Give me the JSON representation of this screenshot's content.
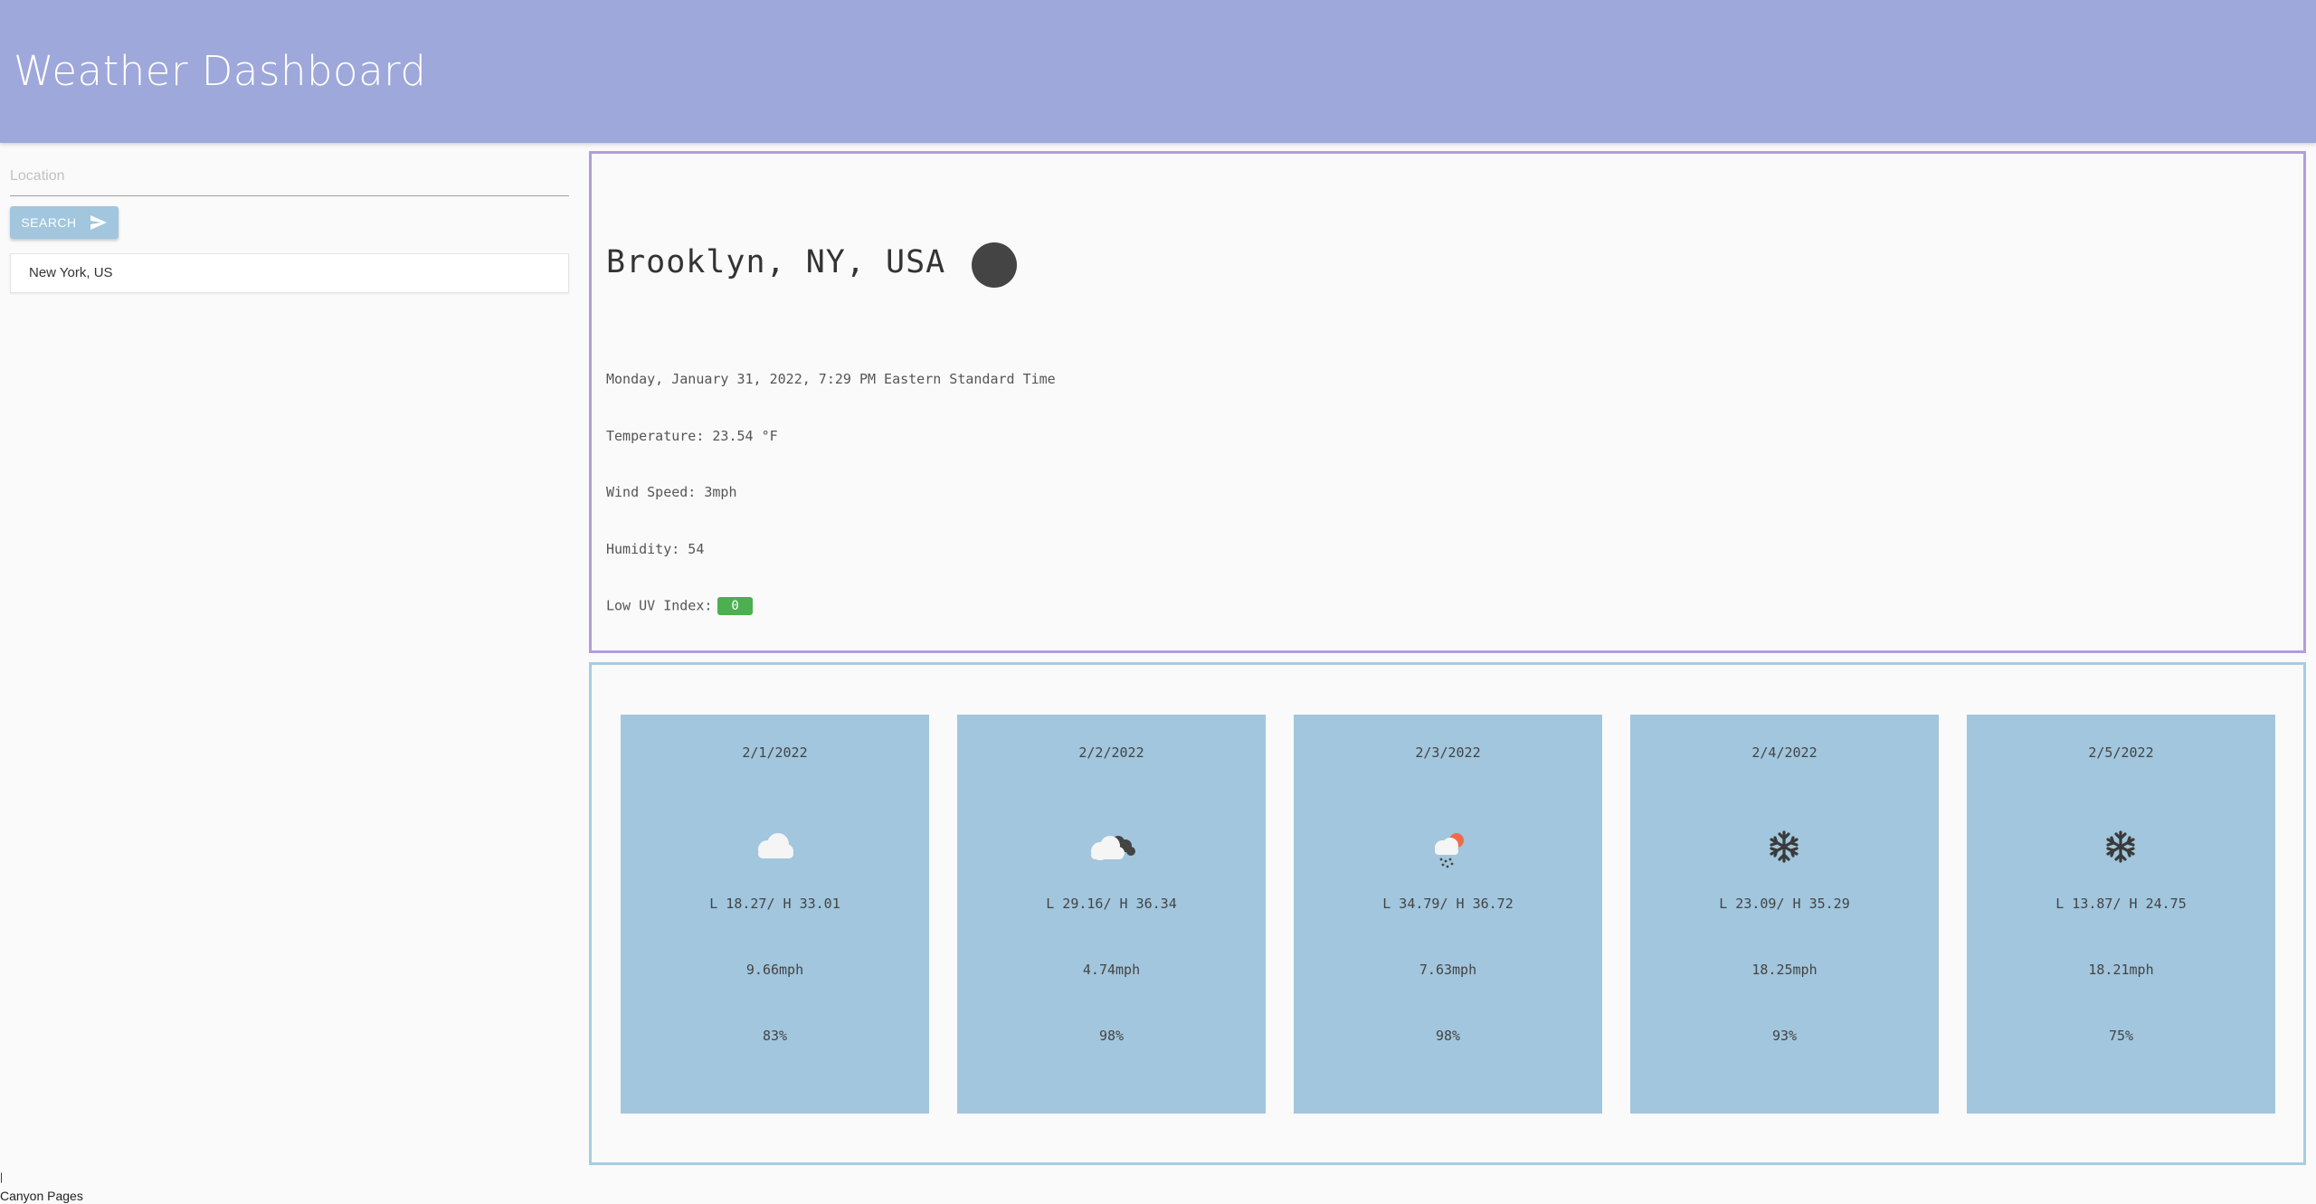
{
  "header": {
    "title": "Weather Dashboard"
  },
  "sidebar": {
    "location_placeholder": "Location",
    "search_label": "SEARCH",
    "history": [
      {
        "label": "New York, US"
      }
    ]
  },
  "current": {
    "city": "Brooklyn, NY, USA",
    "datetime": "Monday, January 31, 2022, 7:29 PM Eastern Standard Time",
    "temperature": "Temperature: 23.54 °F",
    "wind": "Wind Speed: 3mph",
    "humidity": "Humidity: 54",
    "uv_label": "Low UV Index:",
    "uv_value": "0"
  },
  "forecast": [
    {
      "date": "2/1/2022",
      "icon": "cloud-icon",
      "temp": "L 18.27/ H 33.01",
      "wind": "9.66mph",
      "humidity": "83%"
    },
    {
      "date": "2/2/2022",
      "icon": "overcast-clouds-icon",
      "temp": "L 29.16/ H 36.34",
      "wind": "4.74mph",
      "humidity": "98%"
    },
    {
      "date": "2/3/2022",
      "icon": "rain-sun-icon",
      "temp": "L 34.79/ H 36.72",
      "wind": "7.63mph",
      "humidity": "98%"
    },
    {
      "date": "2/4/2022",
      "icon": "snowflake-icon",
      "temp": "L 23.09/ H 35.29",
      "wind": "18.25mph",
      "humidity": "93%"
    },
    {
      "date": "2/5/2022",
      "icon": "snowflake-icon",
      "temp": "L 13.87/ H 24.75",
      "wind": "18.21mph",
      "humidity": "75%"
    }
  ],
  "footer": {
    "mark": "|",
    "text": "Canyon Pages"
  },
  "colors": {
    "header": "#9fa8da",
    "card": "#a1c6dd",
    "uv_badge": "#4caf50",
    "current_border": "#b39ddb",
    "forecast_border": "#a6cde0"
  }
}
